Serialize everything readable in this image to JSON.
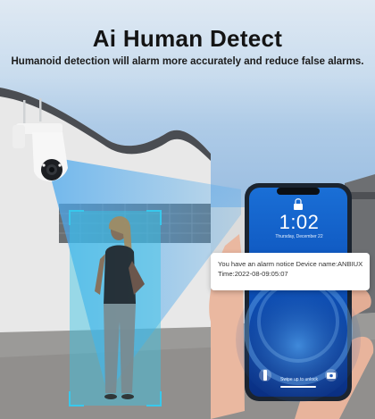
{
  "header": {
    "title": "Ai Human Detect",
    "subtitle": "Humanoid detection will alarm more accurately and reduce false alarms."
  },
  "notification": {
    "line1": "You have an alarm notice Device name:ANBIUX",
    "line2": "Time:2022-08-09:05:07"
  },
  "phone": {
    "time": "1:02",
    "date": "Thursday, December 22",
    "unlock_hint": "Swipe up to unlock"
  },
  "icons": [
    "camera-icon",
    "flashlight-icon",
    "lock-icon"
  ],
  "colors": {
    "detection_frame": "#38c8ec",
    "background_sky": "#9ec0e2"
  }
}
